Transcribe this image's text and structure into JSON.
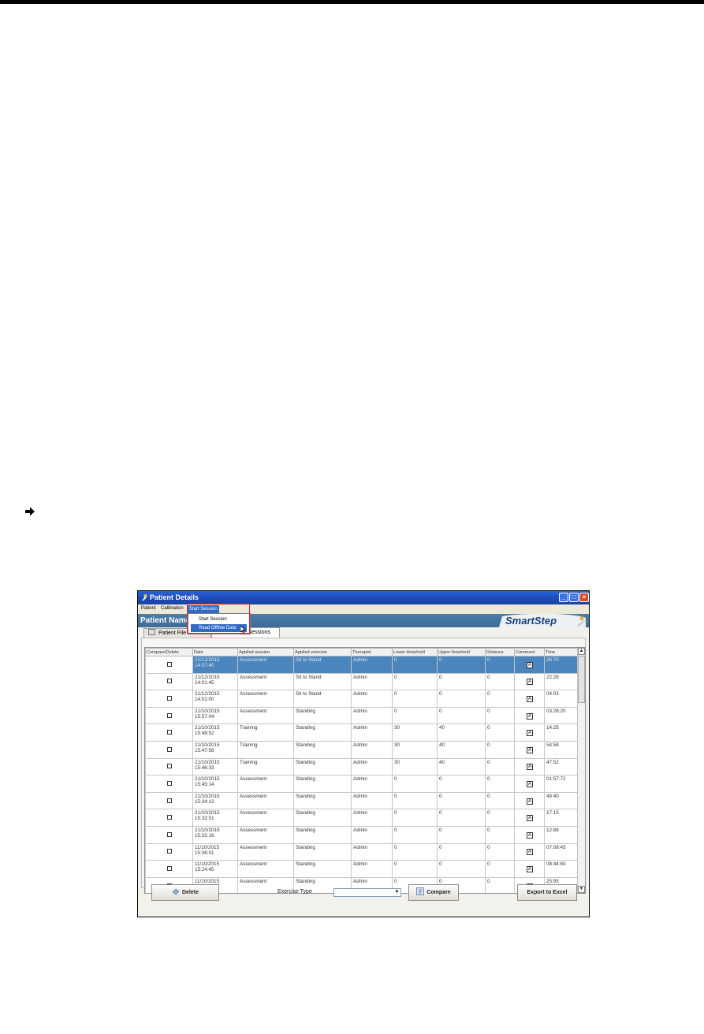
{
  "window": {
    "title": "Patient Details",
    "controls": [
      "minimize-icon",
      "maximize-icon",
      "close-icon"
    ]
  },
  "menu": {
    "items": [
      "Patient",
      "Calibration",
      "Start Session"
    ],
    "open_menu": "Start Session",
    "dropdown": [
      "Start Session",
      "Read Offline Data"
    ],
    "highlighted": "Read Offline Data"
  },
  "header": {
    "patient_name_label": "Patient Name:",
    "logo_text": "SmartStep"
  },
  "tabs": [
    {
      "label": "Patient File",
      "icon": "file-icon"
    },
    {
      "label": "Therapy Sessions",
      "icon": "sessions-icon"
    }
  ],
  "table": {
    "columns": [
      "Compare/Delete",
      "Date",
      "Applied session",
      "Applied exercise",
      "Therapist",
      "Lower threshold",
      "Upper threshold",
      "Distance",
      "Comment",
      "Time"
    ],
    "rows": [
      {
        "date": "21/12/2015",
        "time_of_day": "14:07:40",
        "session": "Assessment",
        "exercise": "Sit to Stand",
        "therapist": "Admin",
        "lower": "0",
        "upper": "0",
        "distance": "0",
        "duration": "26:70",
        "selected": true
      },
      {
        "date": "21/12/2015",
        "time_of_day": "14:01:45",
        "session": "Assessment",
        "exercise": "Sit to Stand",
        "therapist": "Admin",
        "lower": "0",
        "upper": "0",
        "distance": "0",
        "duration": "22:28",
        "selected": false
      },
      {
        "date": "21/12/2015",
        "time_of_day": "14:01:00",
        "session": "Assessment",
        "exercise": "Sit to Stand",
        "therapist": "Admin",
        "lower": "0",
        "upper": "0",
        "distance": "0",
        "duration": "04:03",
        "selected": false
      },
      {
        "date": "21/10/2015",
        "time_of_day": "15:57:04",
        "session": "Assessment",
        "exercise": "Standing",
        "therapist": "Admin",
        "lower": "0",
        "upper": "0",
        "distance": "0",
        "duration": "03:26:20",
        "selected": false
      },
      {
        "date": "21/10/2015",
        "time_of_day": "15:48:52",
        "session": "Training",
        "exercise": "Standing",
        "therapist": "Admin",
        "lower": "30",
        "upper": "40",
        "distance": "0",
        "duration": "14:25",
        "selected": false
      },
      {
        "date": "21/10/2015",
        "time_of_day": "15:47:56",
        "session": "Training",
        "exercise": "Standing",
        "therapist": "Admin",
        "lower": "30",
        "upper": "40",
        "distance": "0",
        "duration": "54:58",
        "selected": false
      },
      {
        "date": "21/10/2015",
        "time_of_day": "15:46:33",
        "session": "Training",
        "exercise": "Standing",
        "therapist": "Admin",
        "lower": "30",
        "upper": "40",
        "distance": "0",
        "duration": "47:52",
        "selected": false
      },
      {
        "date": "21/10/2015",
        "time_of_day": "15:45:14",
        "session": "Assessment",
        "exercise": "Standing",
        "therapist": "Admin",
        "lower": "0",
        "upper": "0",
        "distance": "0",
        "duration": "01:57:72",
        "selected": false
      },
      {
        "date": "21/10/2015",
        "time_of_day": "15:34:12",
        "session": "Assessment",
        "exercise": "Standing",
        "therapist": "Admin",
        "lower": "0",
        "upper": "0",
        "distance": "0",
        "duration": "48:40",
        "selected": false
      },
      {
        "date": "21/10/2015",
        "time_of_day": "15:32:51",
        "session": "Assessment",
        "exercise": "Standing",
        "therapist": "Admin",
        "lower": "0",
        "upper": "0",
        "distance": "0",
        "duration": "17:15",
        "selected": false
      },
      {
        "date": "21/10/2015",
        "time_of_day": "15:32:16",
        "session": "Assessment",
        "exercise": "Standing",
        "therapist": "Admin",
        "lower": "0",
        "upper": "0",
        "distance": "0",
        "duration": "12:88",
        "selected": false
      },
      {
        "date": "11/10/2015",
        "time_of_day": "15:36:51",
        "session": "Assessment",
        "exercise": "Standing",
        "therapist": "Admin",
        "lower": "0",
        "upper": "0",
        "distance": "0",
        "duration": "07:08:45",
        "selected": false
      },
      {
        "date": "11/10/2015",
        "time_of_day": "15:24:45",
        "session": "Assessment",
        "exercise": "Standing",
        "therapist": "Admin",
        "lower": "0",
        "upper": "0",
        "distance": "0",
        "duration": "08:44:60",
        "selected": false
      },
      {
        "date": "11/10/2015",
        "time_of_day": "",
        "session": "Assessment",
        "exercise": "Standing",
        "therapist": "Admin",
        "lower": "0",
        "upper": "0",
        "distance": "0",
        "duration": "25:95",
        "selected": false
      }
    ]
  },
  "footer": {
    "delete_label": "Delete",
    "exercise_type_label": "Exercise Type",
    "exercise_type_value": "",
    "compare_label": "Compare",
    "export_label": "Export to Excel"
  },
  "colors": {
    "title_bar": "#1b49b6",
    "header_band": "#4c7ea8",
    "selected_row": "#4a86bd",
    "menu_highlight": "#316ac5",
    "callout_outline": "#e0242b"
  }
}
